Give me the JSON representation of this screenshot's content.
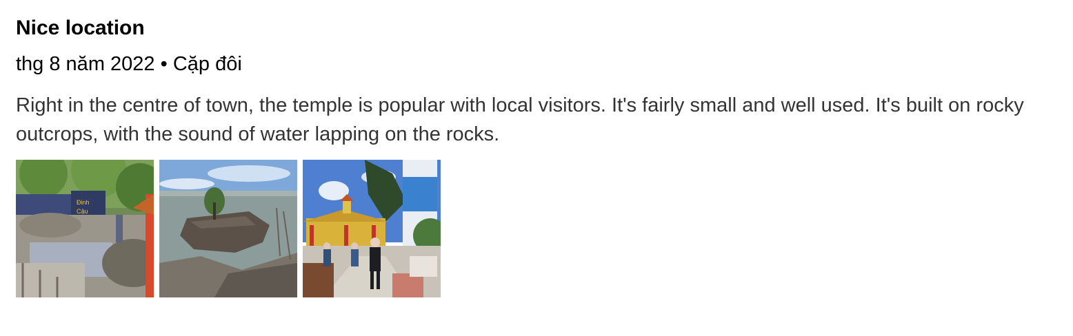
{
  "review": {
    "title": "Nice location",
    "date": "thg 8 năm 2022",
    "separator": "•",
    "trip_type": "Cặp đôi",
    "text": "Right in the centre of town, the temple is popular with local visitors. It's fairly small and well used. It's built on rocky outcrops, with the sound of water lapping on the rocks."
  },
  "photos": [
    {
      "subject": "temple-wall-rocks"
    },
    {
      "subject": "sea-rock-outcrop"
    },
    {
      "subject": "temple-courtyard-lighthouse"
    }
  ]
}
